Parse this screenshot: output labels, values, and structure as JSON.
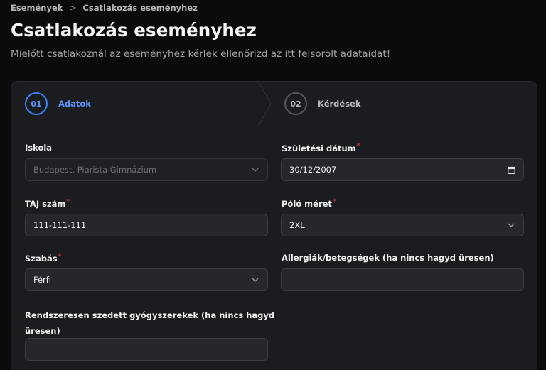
{
  "breadcrumb": {
    "items": [
      "Események",
      "Csatlakozás eseményhez"
    ],
    "separator": ">"
  },
  "page": {
    "title": "Csatlakozás eseményhez",
    "subtitle": "Mielőtt csatlakoznál az eseményhez kérlek ellenőrizd az itt felsorolt adataidat!"
  },
  "steps": [
    {
      "number": "01",
      "label": "Adatok",
      "active": true
    },
    {
      "number": "02",
      "label": "Kérdések",
      "active": false
    }
  ],
  "form": {
    "school": {
      "label": "Iskola",
      "value": "Budapest, Piarista Gimnázium",
      "disabled": true
    },
    "birthdate": {
      "label": "Születési dátum",
      "value": "30/12/2007",
      "required": true
    },
    "taj": {
      "label": "TAJ szám",
      "value": "111-111-111",
      "required": true
    },
    "shirt": {
      "label": "Póló méret",
      "value": "2XL",
      "required": true
    },
    "cut": {
      "label": "Szabás",
      "value": "Férfi",
      "required": true
    },
    "allergies": {
      "label": "Allergiák/betegségek (ha nincs hagyd üresen)",
      "value": ""
    },
    "medication": {
      "label_line1": "Rendszeresen szedett gyógyszerekek (ha nincs hagyd",
      "label_line2": "üresen)",
      "value": ""
    }
  },
  "colors": {
    "accent": "#3d82f5",
    "required": "#e0383b",
    "background": "#0b0b0d",
    "card": "#1b1c1f"
  },
  "icons": {
    "select": "chevron-down-icon",
    "date": "calendar-icon"
  }
}
